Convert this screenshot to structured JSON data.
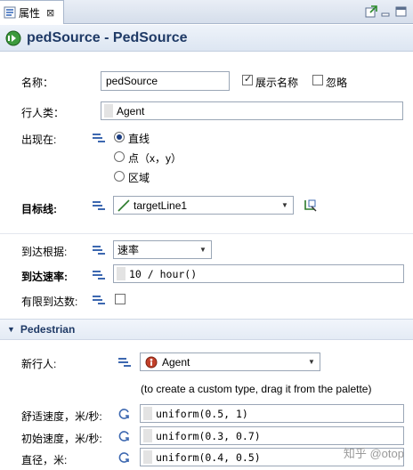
{
  "tab": {
    "label": "属性",
    "close": "⊠"
  },
  "header": {
    "title": "pedSource - PedSource"
  },
  "form": {
    "name_label": "名称：",
    "name_value": "pedSource",
    "show_name_label": "展示名称",
    "show_name_checked": true,
    "ignore_label": "忽略",
    "ignore_checked": false,
    "ped_type_label": "行人类：",
    "ped_type_value": "Agent",
    "appear_label": "出现在:",
    "appear_options": [
      "直线",
      "点（x，y）",
      "区域"
    ],
    "appear_selected": 0,
    "target_label": "目标线:",
    "target_value": "targetLine1",
    "arrival_basis_label": "到达根据:",
    "arrival_basis_value": "速率",
    "arrival_rate_label": "到达速率:",
    "arrival_rate_value": "10 / hour()",
    "limited_label": "有限到达数:",
    "limited_checked": false
  },
  "pedestrian": {
    "section_title": "Pedestrian",
    "new_ped_label": "新行人:",
    "new_ped_value": "Agent",
    "hint": "(to create a custom type, drag it from the palette)",
    "comfort_speed_label": "舒适速度，米/秒:",
    "comfort_speed_value": "uniform(0.5, 1)",
    "initial_speed_label": "初始速度，米/秒:",
    "initial_speed_value": "uniform(0.3, 0.7)",
    "diameter_label": "直径，米:",
    "diameter_value": "uniform(0.4, 0.5)"
  },
  "watermark": "知乎 @otop",
  "colors": {
    "accent": "#1f3a66",
    "icon_blue": "#3d68b0",
    "header_bg": "#dde6f2"
  }
}
